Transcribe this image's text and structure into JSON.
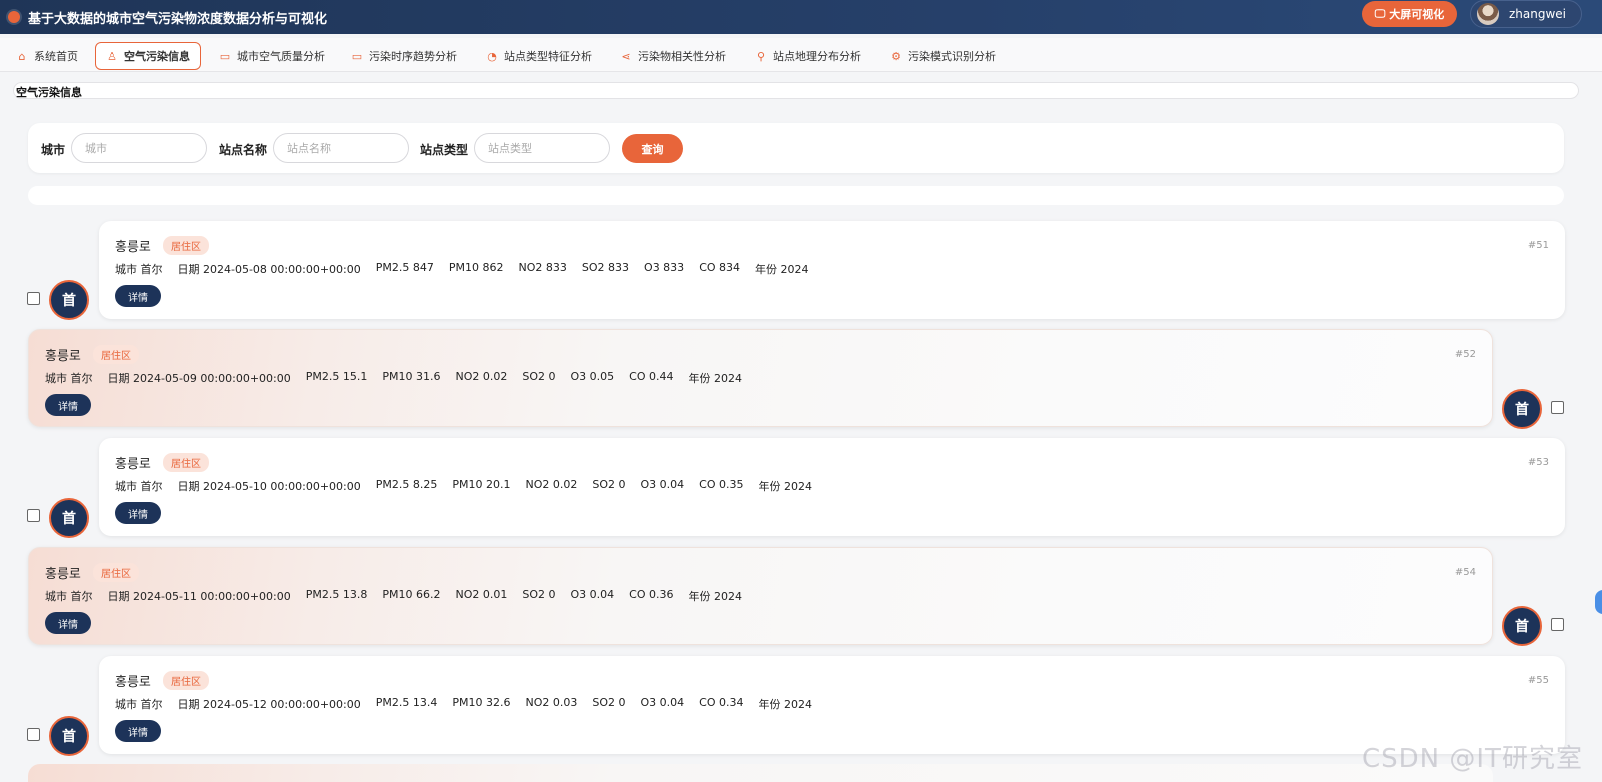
{
  "app": {
    "title": "基于大数据的城市空气污染物浓度数据分析与可视化",
    "bigscreen_label": "大屏可视化",
    "username": "zhangwei"
  },
  "nav": [
    {
      "label": "系统首页",
      "icon": "home-icon",
      "glyph": "⌂"
    },
    {
      "label": "空气污染信息",
      "icon": "user-icon",
      "glyph": "♙",
      "active": true
    },
    {
      "label": "城市空气质量分析",
      "icon": "chart-board-icon",
      "glyph": "▭"
    },
    {
      "label": "污染时序趋势分析",
      "icon": "chart-board-icon",
      "glyph": "▭"
    },
    {
      "label": "站点类型特征分析",
      "icon": "pie-icon",
      "glyph": "◔"
    },
    {
      "label": "污染物相关性分析",
      "icon": "share-icon",
      "glyph": "⋖"
    },
    {
      "label": "站点地理分布分析",
      "icon": "location-pin-icon",
      "glyph": "⚲"
    },
    {
      "label": "污染模式识别分析",
      "icon": "chip-icon",
      "glyph": "⚙"
    }
  ],
  "breadcrumb": "空气污染信息",
  "search": {
    "city_label": "城市",
    "city_placeholder": "城市",
    "station_label": "站点名称",
    "station_placeholder": "站点名称",
    "type_label": "站点类型",
    "type_placeholder": "站点类型",
    "query_label": "查询"
  },
  "records": [
    {
      "station": "홍릉로",
      "tag": "居住区",
      "id": "#51",
      "badge": "首",
      "detail": "详情",
      "fields": [
        "城市 首尔",
        "日期 2024-05-08 00:00:00+00:00",
        "PM2.5 847",
        "PM10 862",
        "NO2 833",
        "SO2 833",
        "O3 833",
        "CO 834",
        "年份 2024"
      ]
    },
    {
      "station": "홍릉로",
      "tag": "居住区",
      "id": "#52",
      "badge": "首",
      "detail": "详情",
      "fields": [
        "城市 首尔",
        "日期 2024-05-09 00:00:00+00:00",
        "PM2.5 15.1",
        "PM10 31.6",
        "NO2 0.02",
        "SO2 0",
        "O3 0.05",
        "CO 0.44",
        "年份 2024"
      ]
    },
    {
      "station": "홍릉로",
      "tag": "居住区",
      "id": "#53",
      "badge": "首",
      "detail": "详情",
      "fields": [
        "城市 首尔",
        "日期 2024-05-10 00:00:00+00:00",
        "PM2.5 8.25",
        "PM10 20.1",
        "NO2 0.02",
        "SO2 0",
        "O3 0.04",
        "CO 0.35",
        "年份 2024"
      ]
    },
    {
      "station": "홍릉로",
      "tag": "居住区",
      "id": "#54",
      "badge": "首",
      "detail": "详情",
      "fields": [
        "城市 首尔",
        "日期 2024-05-11 00:00:00+00:00",
        "PM2.5 13.8",
        "PM10 66.2",
        "NO2 0.01",
        "SO2 0",
        "O3 0.04",
        "CO 0.36",
        "年份 2024"
      ]
    },
    {
      "station": "홍릉로",
      "tag": "居住区",
      "id": "#55",
      "badge": "首",
      "detail": "详情",
      "fields": [
        "城市 首尔",
        "日期 2024-05-12 00:00:00+00:00",
        "PM2.5 13.4",
        "PM10 32.6",
        "NO2 0.03",
        "SO2 0",
        "O3 0.04",
        "CO 0.34",
        "年份 2024"
      ]
    }
  ],
  "watermark": "CSDN @IT研究室",
  "colors": {
    "accent": "#e8653a",
    "navy": "#1d3359",
    "header": "#1f3557"
  }
}
